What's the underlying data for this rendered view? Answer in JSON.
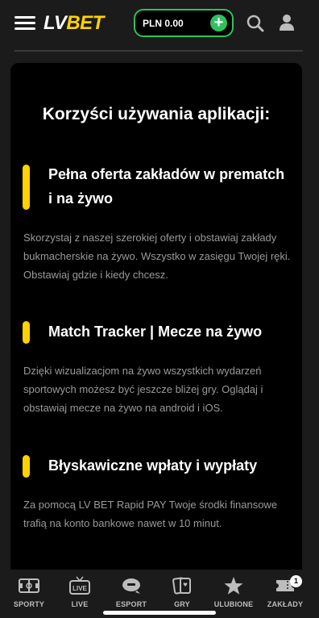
{
  "header": {
    "logo": {
      "lv": "LV",
      "bet": "BET"
    },
    "balance": "PLN 0.00",
    "plus": "+"
  },
  "card": {
    "title": "Korzyści używania aplikacji:",
    "features": [
      {
        "title": "Pełna oferta zakładów w prematch i na żywo",
        "desc": "Skorzystaj z naszej szerokiej oferty i obstawiaj zakłady bukmacherskie na żywo. Wszystko w zasięgu Twojej ręki. Obstawiaj gdzie i kiedy chcesz."
      },
      {
        "title": "Match Tracker | Mecze na żywo",
        "desc": "Dzięki wizualizacjom na żywo wszystkich wydarzeń sportowych możesz być jeszcze bliżej gry. Oglądaj i obstawiaj mecze na żywo na android i iOS."
      },
      {
        "title": "Błyskawiczne wpłaty i wypłaty",
        "desc": "Za pomocą LV BET Rapid PAY Twoje środki finansowe trafią na konto bankowe nawet w 10 minut."
      }
    ]
  },
  "bottom_nav": {
    "items": [
      {
        "label": "SPORTY",
        "icon": "sports-field-icon"
      },
      {
        "label": "LIVE",
        "icon": "live-tv-icon",
        "icon_text": "LIVE"
      },
      {
        "label": "ESPORT",
        "icon": "gamepad-icon"
      },
      {
        "label": "GRY",
        "icon": "cards-icon"
      },
      {
        "label": "ULUBIONE",
        "icon": "star-icon"
      },
      {
        "label": "ZAKŁADY",
        "icon": "ticket-icon",
        "badge": "1"
      }
    ]
  },
  "colors": {
    "brand_yellow": "#ffd200",
    "accent_green": "#2ec15f",
    "background": "#1b1b1b",
    "card": "#000000",
    "muted_text": "#9a9a9a"
  }
}
